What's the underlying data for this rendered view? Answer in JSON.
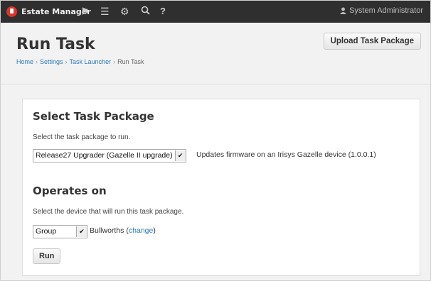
{
  "topbar": {
    "brand": "Estate Manager",
    "icons": [
      "home-icon",
      "list-icon",
      "gear-icon",
      "search-icon",
      "help-icon"
    ],
    "user": "System Administrator"
  },
  "header": {
    "title": "Run Task",
    "upload_button": "Upload Task Package",
    "breadcrumb": [
      "Home",
      "Settings",
      "Task Launcher",
      "Run Task"
    ]
  },
  "select_package": {
    "heading": "Select Task Package",
    "help": "Select the task package to run.",
    "selected": "Release27 Upgrader (Gazelle II upgrade)",
    "description": "Updates firmware on an Irisys Gazelle device (1.0.0.1)"
  },
  "operates_on": {
    "heading": "Operates on",
    "help": "Select the device that will run this task package.",
    "selected": "Group",
    "target": "Bullworths (",
    "change_link": "change",
    "close_paren": ")"
  },
  "run_button": "Run"
}
